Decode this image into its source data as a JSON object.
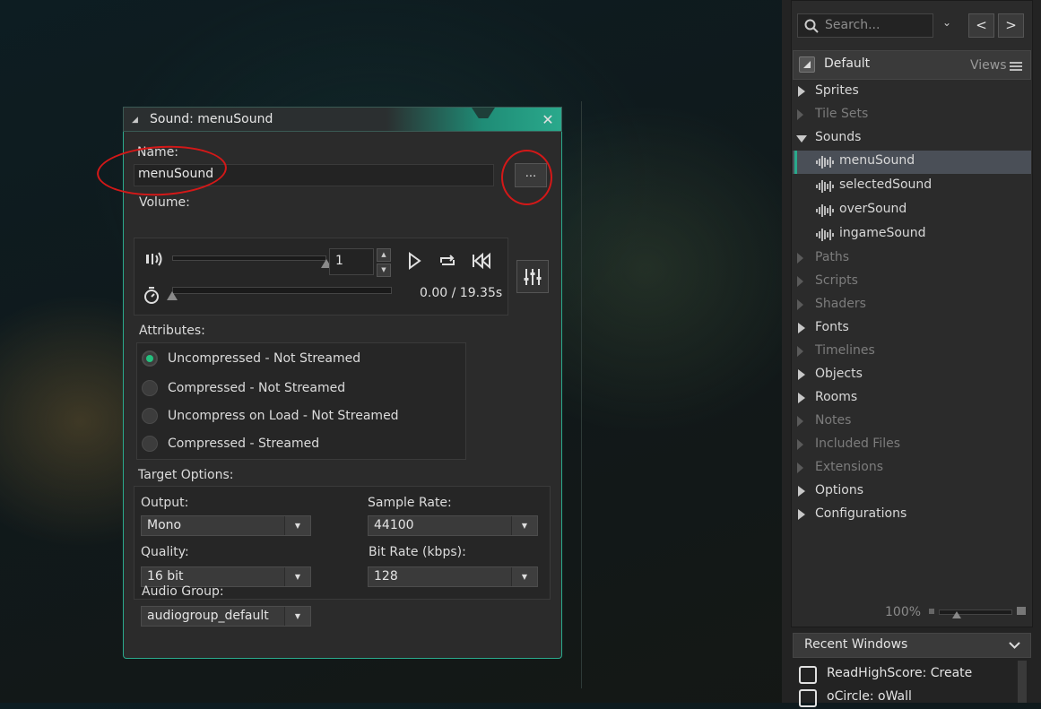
{
  "window": {
    "title": "Sound: menuSound",
    "close_glyph": "✕",
    "name_label": "Name:",
    "name_value": "menuSound",
    "browse_label": "...",
    "volume_label": "Volume:",
    "volume_value": "1",
    "volume_level": 1.0,
    "playback_position": 0.0,
    "time_readout": "0.00 / 19.35s",
    "attributes_label": "Attributes:",
    "attributes": [
      {
        "label": "Uncompressed - Not Streamed",
        "selected": true
      },
      {
        "label": "Compressed - Not Streamed",
        "selected": false
      },
      {
        "label": "Uncompress on Load - Not Streamed",
        "selected": false
      },
      {
        "label": "Compressed - Streamed",
        "selected": false
      }
    ],
    "target_options_label": "Target Options:",
    "output": {
      "label": "Output:",
      "value": "Mono"
    },
    "sample_rate": {
      "label": "Sample Rate:",
      "value": "44100"
    },
    "quality": {
      "label": "Quality:",
      "value": "16 bit"
    },
    "bit_rate": {
      "label": "Bit Rate (kbps):",
      "value": "128"
    },
    "audio_group": {
      "label": "Audio Group:",
      "value": "audiogroup_default"
    }
  },
  "asset_browser": {
    "search_placeholder": "Search...",
    "back_glyph": "<",
    "forward_glyph": ">",
    "default_label": "Default",
    "views_label": "Views",
    "tree": [
      {
        "label": "Sprites",
        "dim": false,
        "open": false
      },
      {
        "label": "Tile Sets",
        "dim": true,
        "open": false
      },
      {
        "label": "Sounds",
        "dim": false,
        "open": true,
        "children": [
          "menuSound",
          "selectedSound",
          "overSound",
          "ingameSound"
        ]
      },
      {
        "label": "Paths",
        "dim": true,
        "open": false
      },
      {
        "label": "Scripts",
        "dim": true,
        "open": false
      },
      {
        "label": "Shaders",
        "dim": true,
        "open": false
      },
      {
        "label": "Fonts",
        "dim": false,
        "open": false
      },
      {
        "label": "Timelines",
        "dim": true,
        "open": false
      },
      {
        "label": "Objects",
        "dim": false,
        "open": false
      },
      {
        "label": "Rooms",
        "dim": false,
        "open": false
      },
      {
        "label": "Notes",
        "dim": true,
        "open": false
      },
      {
        "label": "Included Files",
        "dim": true,
        "open": false
      },
      {
        "label": "Extensions",
        "dim": true,
        "open": false
      },
      {
        "label": "Options",
        "dim": false,
        "open": false
      },
      {
        "label": "Configurations",
        "dim": false,
        "open": false
      }
    ],
    "selected_child": "menuSound",
    "zoom": "100%",
    "recent_windows_label": "Recent Windows",
    "recent_windows": [
      "ReadHighScore: Create",
      "oCircle: oWall"
    ]
  },
  "colors": {
    "accent": "#2aa98c",
    "radio_on": "#24c07e",
    "annotation": "#d41818"
  }
}
